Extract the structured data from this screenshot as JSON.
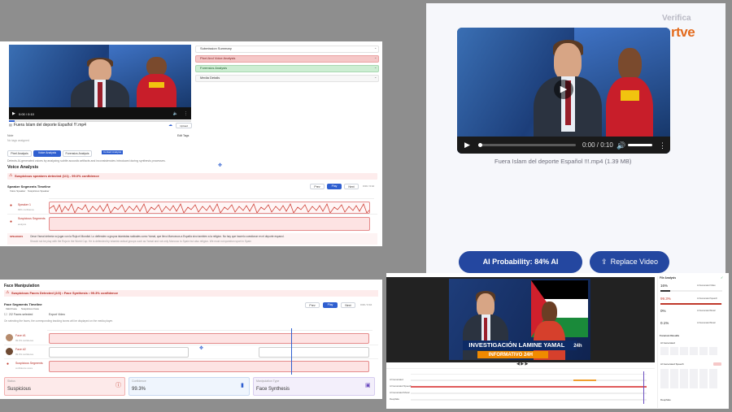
{
  "panel1": {
    "video_time": "0:00 / 0:10",
    "file_name": "Fuera Islam del deporte Español !!!.mp4",
    "upload_label": "Upload",
    "note_label": "Note",
    "note_placeholder": "No tags assigned",
    "edit_tags": "Edit Tags",
    "tabs": [
      "Pixel Analysis",
      "Voice Analysis",
      "Forensics Analysis"
    ],
    "tab_badge": "Contact Analysis",
    "description": "Detects AI-generated voices by analyzing subtle acoustic artifacts and inconsistencies introduced during synthesis processes.",
    "section_title": "Voice Analysis",
    "detected": "Suspicious speakers detected (1/1) - 99.0% confidence",
    "timeline_title": "Speaker Segments Timeline",
    "legend": [
      "Voice Speaker",
      "Suspicious Speaker"
    ],
    "btn_prev": "Prev",
    "btn_play": "Play",
    "btn_next": "Next",
    "time_readout": "0:00 / 0:10",
    "speaker1": "Speaker 1",
    "speaker1_sub": "99% confidence",
    "speaker2": "Suspicious Segments",
    "speaker2_sub": "analysis",
    "transcript_tag": "SPEAKER1",
    "transcript": "Omar Yamal deberia no jugar con la Roja el Mundial. Lo defienden a grupos islamistas radicales como Yamal, que llevo Marruecos a España sino tambien a la religion. No hay que hacerlo cuestionar en el deporte espanol.",
    "transcript_2": "Should not be play with the Roja in the World Cup. He is defended by Islamist radical groups such as Yamal and not only Morocco to Spain but also religion. We must not question sport in Spain",
    "accordion": [
      "Submission Summary",
      "Pixel And Voice Analysis",
      "Forensics Analysis",
      "Media Details"
    ]
  },
  "panel2": {
    "brand_top": "Verifica",
    "brand": "rtve",
    "time": "0:00 / 0:10",
    "file_name": "Fuera Islam del deporte Español !!!.mp4 (1.39 MB)",
    "probability_label": "AI Probability: 84% AI",
    "replace_label": "Replace Video"
  },
  "panel3": {
    "title": "Face Manipulation",
    "detected": "Suspicious Faces Detected (2/2) • Face Synthesis • 99.3% confidence",
    "timeline_title": "Face Segments Timeline",
    "legend": [
      "Valid Face",
      "Suspicious Face"
    ],
    "faces_selected": "2/2 Faces selected",
    "export": "Export Video",
    "hint": "On selecting the faces, the corresponding tracking boxes will be displayed on the media player.",
    "btn_prev": "Prev",
    "btn_play": "Play",
    "btn_next": "Next",
    "time_readout": "0:00 / 0:10",
    "face1": "Face #1",
    "face1_sub": "99.3% confidence",
    "face2": "Face #2",
    "face2_sub": "99.3% confidence",
    "face3": "Suspicious Segments",
    "face3_sub": "confidence score",
    "card_status_label": "Status",
    "card_status_value": "Suspicious",
    "card_conf_label": "Confidence",
    "card_conf_value": "99.3%",
    "card_type_label": "Manipulation Type",
    "card_type_value": "Face Synthesis"
  },
  "panel4": {
    "headline": "INVESTIGACIÓN LAMINE YAMAL",
    "subline": "INFORMATIVO 24H",
    "channel": "24h",
    "sidebar_title": "File Analysis",
    "stats": [
      {
        "value": "16%",
        "label": "AI Generated Video"
      },
      {
        "value": "99.3%",
        "label": "AI Generated Speech"
      },
      {
        "value": "0%",
        "label": "AI Generated Music"
      },
      {
        "value": "0.1%",
        "label": "AI Generated Music"
      }
    ],
    "track_labels": [
      "AI Generated",
      "AI Generated Speech",
      "AI Generated Music",
      "Deepfake"
    ],
    "face_results": "Forensic Results",
    "ai_generated": "AI Generated",
    "ai_speech": "AI Generated Speech",
    "deepfake": "Deepfake"
  }
}
